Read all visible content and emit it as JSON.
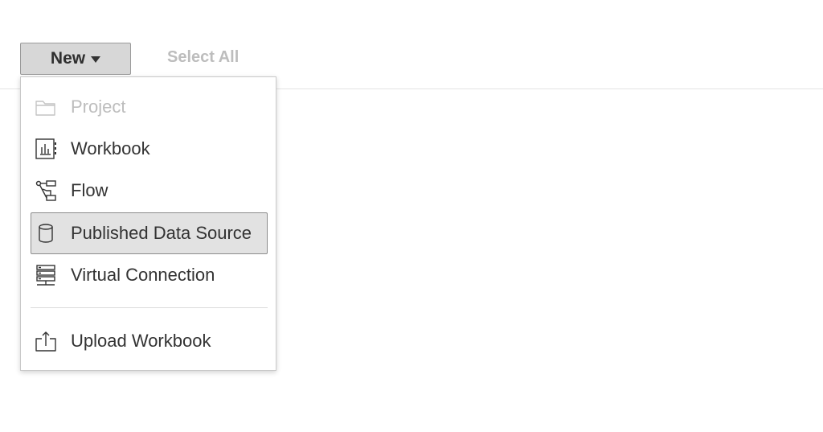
{
  "toolbar": {
    "new_label": "New",
    "select_all_label": "Select All"
  },
  "menu": {
    "items": [
      {
        "label": "Project",
        "icon": "folder-icon",
        "enabled": false
      },
      {
        "label": "Workbook",
        "icon": "workbook-icon",
        "enabled": true
      },
      {
        "label": "Flow",
        "icon": "flow-icon",
        "enabled": true
      },
      {
        "label": "Published Data Source",
        "icon": "database-icon",
        "enabled": true,
        "hovered": true
      },
      {
        "label": "Virtual Connection",
        "icon": "virtual-connection-icon",
        "enabled": true
      }
    ],
    "upload": {
      "label": "Upload Workbook",
      "icon": "upload-icon",
      "enabled": true
    }
  },
  "colors": {
    "disabled_text": "#bdbdbd",
    "button_bg": "#d7d7d7",
    "highlight_bg": "#e2e2e2",
    "text": "#333333"
  }
}
